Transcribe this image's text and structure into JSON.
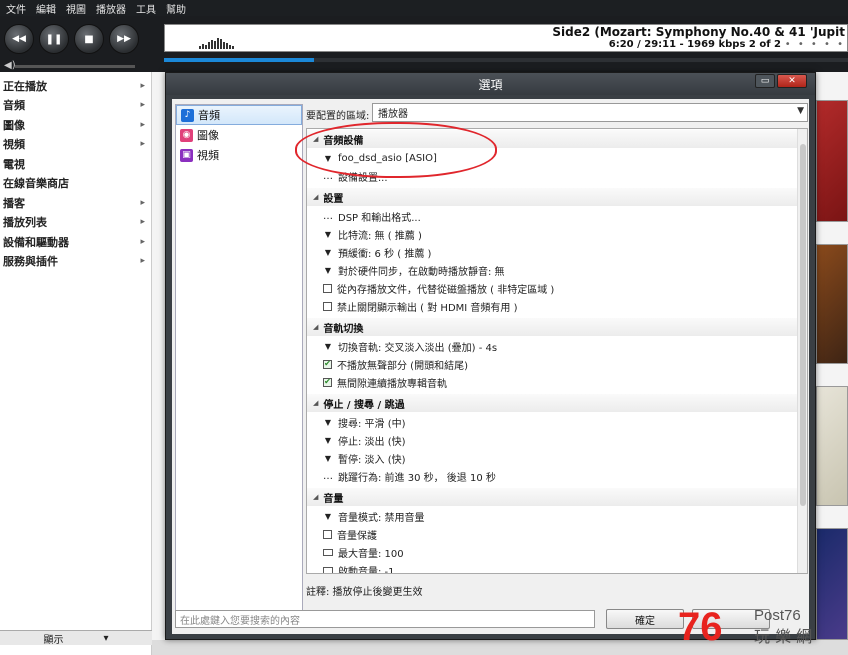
{
  "menu": [
    "文件",
    "編輯",
    "視圖",
    "播放器",
    "工具",
    "幫助"
  ],
  "now_playing": {
    "title": "Side2 (Mozart: Symphony No.40 & 41 'Jupit",
    "info": "6:20 / 29:11 - 1969 kbps   2 of 2",
    "dots": "• • • • •",
    "progress": 0.22
  },
  "transport": {
    "prev_icon": "rewind-icon",
    "pause_icon": "pause-icon",
    "stop_icon": "stop-icon",
    "next_icon": "fast-forward-icon",
    "prev": "◀◀",
    "pause": "❚❚",
    "stop": "■",
    "next": "▶▶"
  },
  "sidebar": {
    "items": [
      {
        "label": "正在播放",
        "arrow": "▸"
      },
      {
        "label": "音頻",
        "arrow": "▸"
      },
      {
        "label": "圖像",
        "arrow": "▸"
      },
      {
        "label": "視頻",
        "arrow": "▸"
      },
      {
        "label": "電視",
        "arrow": ""
      },
      {
        "label": "在線音樂商店",
        "arrow": ""
      },
      {
        "label": "播客",
        "arrow": "▸"
      },
      {
        "label": "播放列表",
        "arrow": "▸"
      },
      {
        "label": "設備和驅動器",
        "arrow": "▸"
      },
      {
        "label": "服務與插件",
        "arrow": "▸"
      }
    ],
    "footer": "顯示"
  },
  "dialog": {
    "title": "選項",
    "categories": [
      {
        "label": "音頻",
        "icon": "music-note-icon",
        "color": "#1d6fd8",
        "glyph": "♪"
      },
      {
        "label": "圖像",
        "icon": "camera-icon",
        "color": "#e0407a",
        "glyph": "◉"
      },
      {
        "label": "視頻",
        "icon": "film-icon",
        "color": "#8b2fbf",
        "glyph": "▣"
      }
    ],
    "area_label": "要配置的區域:",
    "area_value": "播放器",
    "groups": {
      "audio_device": "音頻設備",
      "settings": "設置",
      "track_switch": "音軌切換",
      "stop_seek_skip": "停止 / 搜尋 / 跳過",
      "volume": "音量"
    },
    "rows": {
      "device": "foo_dsd_asio [ASIO]",
      "device_settings": "設備設置...",
      "dsp": "DSP 和輸出格式...",
      "bitstream": "比特流: 無 ( 推薦 )",
      "prebuffer": "預緩衝: 6 秒 ( 推薦 )",
      "hw_sync": "對於硬件同步，在啟動時播放靜音: 無",
      "mem_play": "從內存播放文件，代替從磁盤播放 ( 非特定區域 )",
      "disable_off": "禁止關閉顯示輸出 ( 對 HDMI 音頻有用 )",
      "switch_track": "切換音軌: 交叉淡入淡出 (疊加) - 4s",
      "no_silence": "不播放無聲部分 (開頭和結尾)",
      "gapless": "無間隙連續播放專輯音軌",
      "seek": "搜尋: 平滑 (中)",
      "stop": "停止: 淡出 (快)",
      "pause": "暫停: 淡入 (快)",
      "skip": "跳躍行為: 前進 30 秒， 後退 10 秒",
      "vol_mode": "音量模式: 禁用音量",
      "vol_protect": "音量保護",
      "max_vol": "最大音量: 100",
      "start_vol": "啟動音量: -1"
    },
    "note": "註釋: 播放停止後變更生效",
    "search_placeholder": "在此處鍵入您要搜索的內容",
    "ok": "確定"
  },
  "watermark": {
    "number": "76",
    "brand": "Post76",
    "cn": "玩 樂 網"
  },
  "colors": {
    "accent": "#1b88d8",
    "annotation": "#e0262c",
    "dialog_frame": "#3a3f44"
  }
}
